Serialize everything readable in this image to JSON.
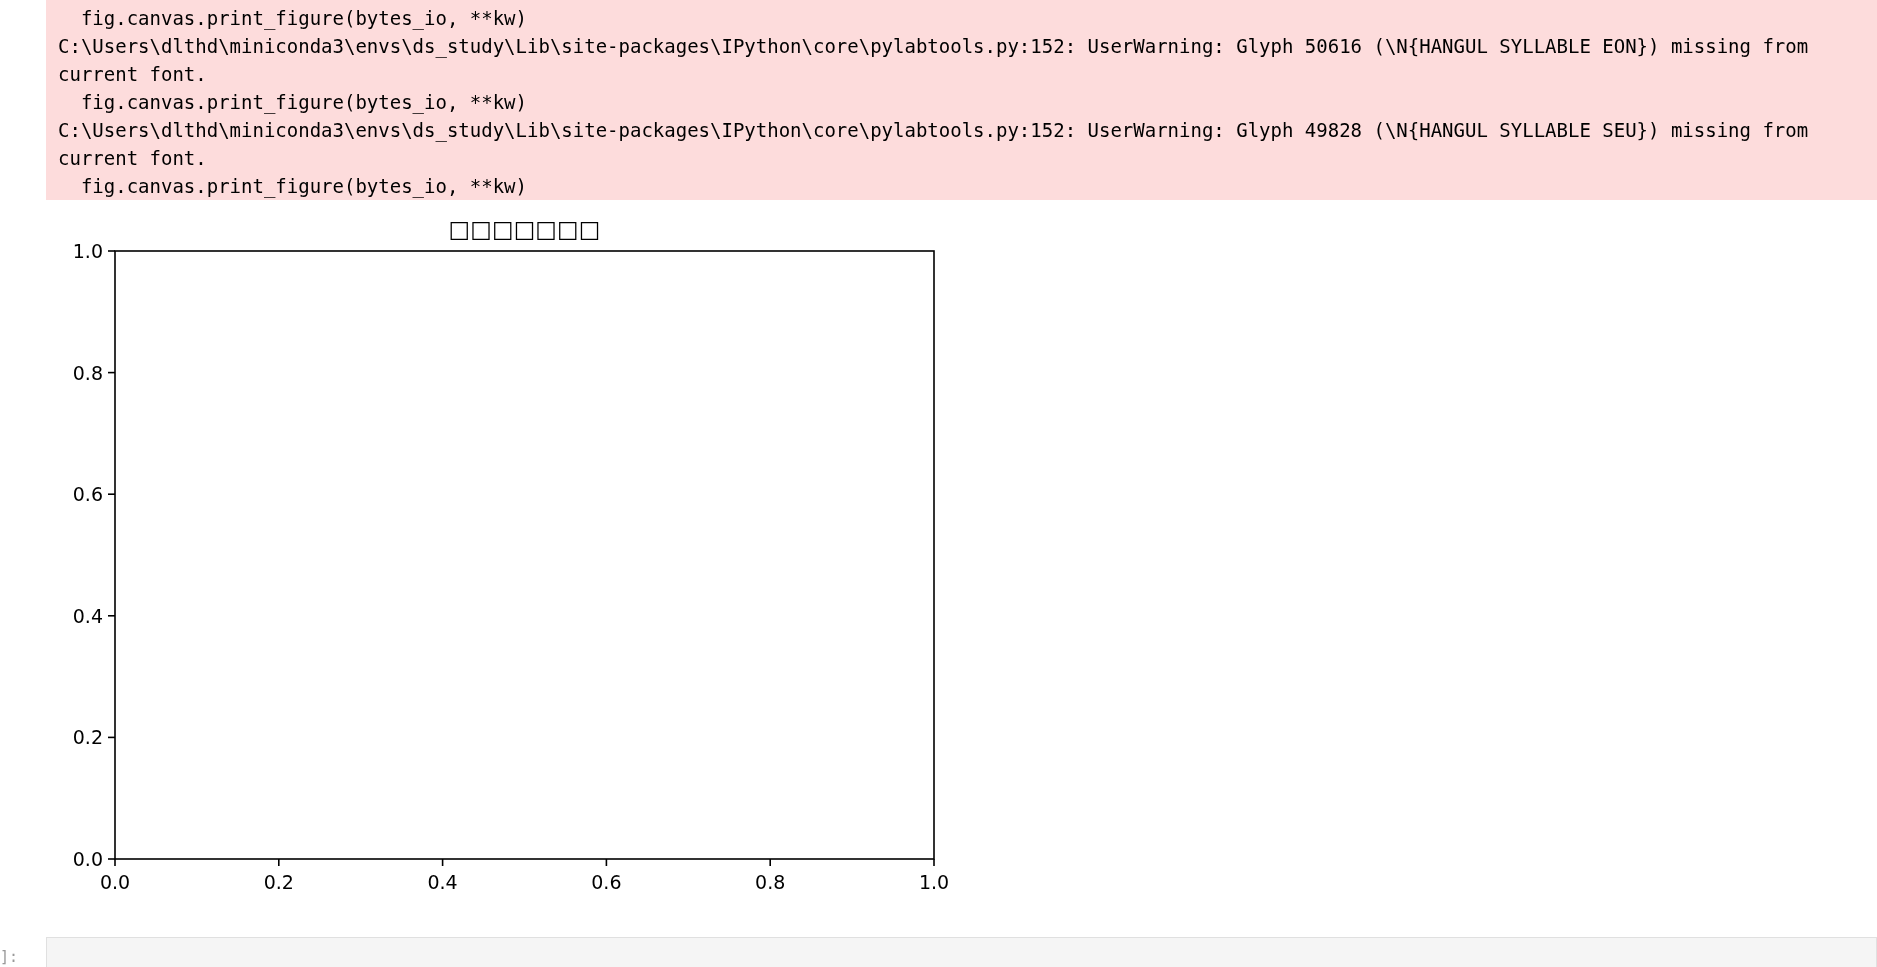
{
  "stderr_output": {
    "lines": [
      "  fig.canvas.print_figure(bytes_io, **kw)",
      "C:\\Users\\dlthd\\miniconda3\\envs\\ds_study\\Lib\\site-packages\\IPython\\core\\pylabtools.py:152: UserWarning: Glyph 50616 (\\N{HANGUL SYLLABLE EON}) missing from",
      "current font.",
      "  fig.canvas.print_figure(bytes_io, **kw)",
      "C:\\Users\\dlthd\\miniconda3\\envs\\ds_study\\Lib\\site-packages\\IPython\\core\\pylabtools.py:152: UserWarning: Glyph 49828 (\\N{HANGUL SYLLABLE SEU}) missing from",
      "current font.",
      "  fig.canvas.print_figure(bytes_io, **kw)"
    ]
  },
  "figure": {
    "chart_data": {
      "type": "line",
      "title": "□□□□□□□",
      "xlim": [
        0,
        1
      ],
      "ylim": [
        0,
        1
      ],
      "xticks": [
        {
          "value": 0,
          "label": "0.0"
        },
        {
          "value": 0.2,
          "label": "0.2"
        },
        {
          "value": 0.4,
          "label": "0.4"
        },
        {
          "value": 0.6,
          "label": "0.6"
        },
        {
          "value": 0.8,
          "label": "0.8"
        },
        {
          "value": 1,
          "label": "1.0"
        }
      ],
      "yticks": [
        {
          "value": 0,
          "label": "0.0"
        },
        {
          "value": 0.2,
          "label": "0.2"
        },
        {
          "value": 0.4,
          "label": "0.4"
        },
        {
          "value": 0.6,
          "label": "0.6"
        },
        {
          "value": 0.8,
          "label": "0.8"
        },
        {
          "value": 1,
          "label": "1.0"
        }
      ]
    }
  },
  "next_cell": {
    "prompt": "]:"
  }
}
